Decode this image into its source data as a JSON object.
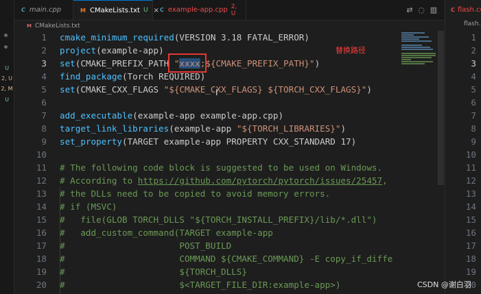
{
  "activity_bar": {
    "badges": [
      "U",
      "2, U",
      "2, M",
      "U"
    ]
  },
  "tabs": [
    {
      "icon": "C",
      "name": "main.cpp",
      "badge": "",
      "state": ""
    },
    {
      "icon": "M",
      "name": "CMakeLists.txt",
      "badge": "U",
      "state": "close"
    },
    {
      "icon": "C",
      "name": "example-app.cpp",
      "badge": "2, U",
      "state": ""
    }
  ],
  "tab_dirty_marker": "●",
  "tab_close_marker": "×",
  "breadcrumb": {
    "icon": "M",
    "file": "CMakeLists.txt"
  },
  "annotation": "替换路径",
  "code_lines": [
    {
      "n": "1",
      "tokens": [
        {
          "t": "cmake_minimum_required",
          "c": "fn"
        },
        {
          "t": "(VERSION 3.18 FATAL_ERROR)",
          "c": ""
        }
      ]
    },
    {
      "n": "2",
      "tokens": [
        {
          "t": "project",
          "c": "fn"
        },
        {
          "t": "(example-app)",
          "c": ""
        }
      ]
    },
    {
      "n": "3",
      "tokens": [
        {
          "t": "set",
          "c": "fn"
        },
        {
          "t": "(CMAKE_PREFIX_PATH ",
          "c": ""
        },
        {
          "t": "\"",
          "c": "s"
        },
        {
          "t": "xxxx",
          "c": "s sel"
        },
        {
          "t": ";${CMAKE_PREFIX_PATH}\"",
          "c": "s"
        },
        {
          "t": ")",
          "c": ""
        }
      ]
    },
    {
      "n": "4",
      "tokens": [
        {
          "t": "find_package",
          "c": "fn"
        },
        {
          "t": "(Torch REQUIRED)",
          "c": ""
        }
      ]
    },
    {
      "n": "5",
      "tokens": [
        {
          "t": "set",
          "c": "fn"
        },
        {
          "t": "(CMAKE_CXX_FLAGS ",
          "c": ""
        },
        {
          "t": "\"${CMAKE_CXX_FLAGS} ${TORCH_CXX_FLAGS}\"",
          "c": "s"
        },
        {
          "t": ")",
          "c": ""
        }
      ]
    },
    {
      "n": "6",
      "tokens": []
    },
    {
      "n": "7",
      "tokens": [
        {
          "t": "add_executable",
          "c": "fn"
        },
        {
          "t": "(example-app example-app.cpp)",
          "c": ""
        }
      ]
    },
    {
      "n": "8",
      "tokens": [
        {
          "t": "target_link_libraries",
          "c": "fn"
        },
        {
          "t": "(example-app ",
          "c": ""
        },
        {
          "t": "\"${TORCH_LIBRARIES}\"",
          "c": "s"
        },
        {
          "t": ")",
          "c": ""
        }
      ]
    },
    {
      "n": "9",
      "tokens": [
        {
          "t": "set_property",
          "c": "fn"
        },
        {
          "t": "(TARGET example-app PROPERTY CXX_STANDARD 17)",
          "c": ""
        }
      ]
    },
    {
      "n": "10",
      "tokens": []
    },
    {
      "n": "11",
      "tokens": [
        {
          "t": "# The following code block is suggested to be used on Windows.",
          "c": "c"
        }
      ]
    },
    {
      "n": "12",
      "tokens": [
        {
          "t": "# According to ",
          "c": "c"
        },
        {
          "t": "https://github.com/pytorch/pytorch/issues/25457",
          "c": "c u"
        },
        {
          "t": ",",
          "c": "c"
        }
      ]
    },
    {
      "n": "13",
      "tokens": [
        {
          "t": "# the DLLs need to be copied to avoid memory errors.",
          "c": "c"
        }
      ]
    },
    {
      "n": "14",
      "tokens": [
        {
          "t": "# if (MSVC)",
          "c": "c"
        }
      ]
    },
    {
      "n": "15",
      "tokens": [
        {
          "t": "#   file(GLOB TORCH_DLLS \"${TORCH_INSTALL_PREFIX}/lib/*.dll\")",
          "c": "c"
        }
      ]
    },
    {
      "n": "16",
      "tokens": [
        {
          "t": "#   add_custom_command(TARGET example-app",
          "c": "c"
        }
      ]
    },
    {
      "n": "17",
      "tokens": [
        {
          "t": "#                      POST_BUILD",
          "c": "c"
        }
      ]
    },
    {
      "n": "18",
      "tokens": [
        {
          "t": "#                      COMMAND ${CMAKE_COMMAND} -E copy_if_diffe",
          "c": "c"
        }
      ]
    },
    {
      "n": "19",
      "tokens": [
        {
          "t": "#                      ${TORCH_DLLS}",
          "c": "c"
        }
      ]
    },
    {
      "n": "20",
      "tokens": [
        {
          "t": "#                      $<TARGET_FILE_DIR:example-app>)",
          "c": "c"
        }
      ]
    }
  ],
  "current_line": "3",
  "right_pane": {
    "tab": {
      "icon": "C",
      "name": "flash.cu"
    },
    "breadcrumb": "flash.cu",
    "line_numbers": [
      "1",
      "2",
      "3",
      "4",
      "5",
      "6",
      "7",
      "8",
      "9",
      "10",
      "11",
      "12",
      "13",
      "14",
      "15",
      "16",
      "17",
      "18",
      "19",
      "20"
    ]
  },
  "watermark": "CSDN @谢白羽",
  "colors": {
    "function": "#4fc1ff",
    "string": "#ce9178",
    "comment": "#6a9955",
    "highlight": "#e53935"
  }
}
